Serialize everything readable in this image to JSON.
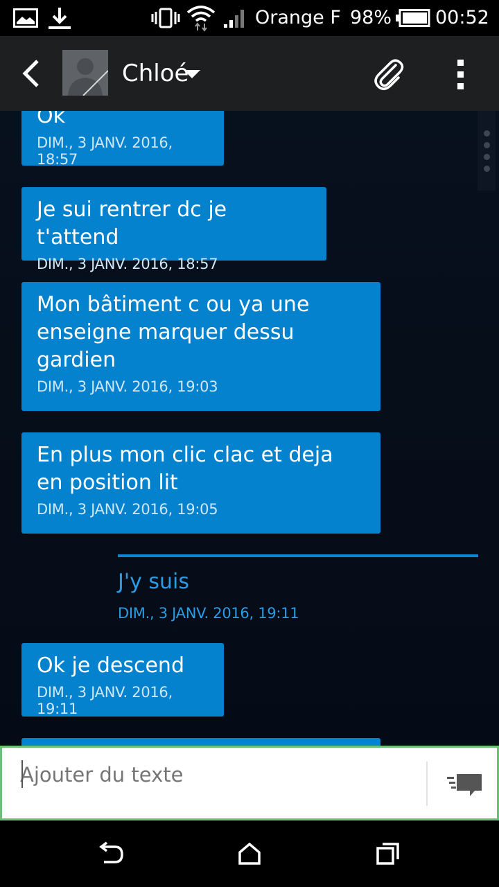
{
  "status_bar": {
    "carrier": "Orange F",
    "battery": "98%",
    "time": "00:52",
    "icons": [
      "image-icon",
      "download-icon",
      "vibrate-icon",
      "wifi-icon",
      "signal-icon",
      "battery-icon"
    ]
  },
  "header": {
    "contact_name": "Chloé",
    "icons": [
      "back-arrow-icon",
      "avatar",
      "dropdown-icon",
      "paperclip-icon",
      "overflow-menu-icon"
    ]
  },
  "conversation": {
    "messages": [
      {
        "text": "Ok",
        "timestamp": "DIM., 3 JANV. 2016, 18:57",
        "direction": "received"
      },
      {
        "text": "Je sui rentrer dc je t'attend",
        "timestamp": "DIM., 3 JANV. 2016, 18:57",
        "direction": "received"
      },
      {
        "text": "Mon bâtiment c ou ya une enseigne marquer dessu gardien",
        "timestamp": "DIM., 3 JANV. 2016, 19:03",
        "direction": "received"
      },
      {
        "text": "En plus mon clic clac et deja en position lit",
        "timestamp": "DIM., 3 JANV. 2016, 19:05",
        "direction": "received"
      },
      {
        "text": "J'y suis",
        "timestamp": "DIM., 3 JANV. 2016, 19:11",
        "direction": "sent"
      },
      {
        "text": "Ok je descend",
        "timestamp": "DIM., 3 JANV. 2016, 19:11",
        "direction": "received"
      }
    ]
  },
  "composer": {
    "placeholder": "Ajouter du texte",
    "send_icon": "send-message-icon"
  },
  "nav_bar": {
    "icons": [
      "back-nav-icon",
      "home-nav-icon",
      "recents-nav-icon"
    ]
  },
  "colors": {
    "bubble": "#0582ce",
    "sent_text": "#2a9de6",
    "background": "#050a14",
    "header": "#1e1f21",
    "composer_border": "#6cbf78"
  }
}
